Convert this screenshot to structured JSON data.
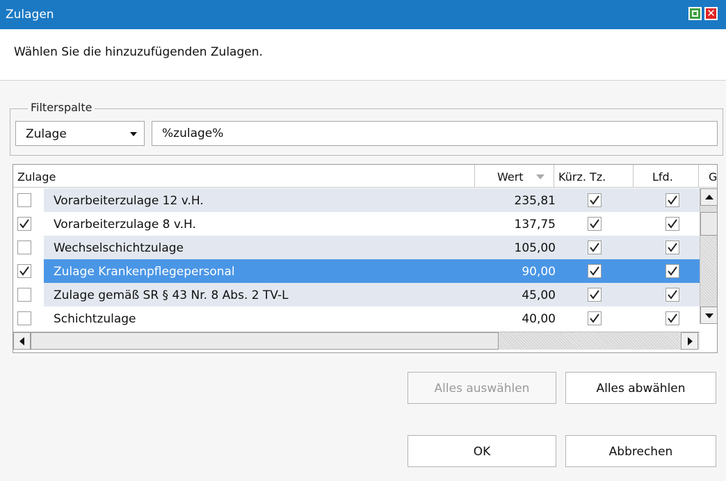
{
  "window": {
    "title": "Zulagen"
  },
  "instruction": "Wählen Sie die hinzuzufügenden Zulagen.",
  "filter": {
    "legend": "Filterspalte",
    "column": "Zulage",
    "value": "%zulage%"
  },
  "table": {
    "columns": [
      "Zulage",
      "Wert",
      "Kürz. Tz.",
      "Lfd.",
      "G"
    ],
    "sort_column": "Wert",
    "rows": [
      {
        "name": "Vorarbeiterzulage 12 v.H.",
        "wert": "235,81",
        "selected": false,
        "kuerz": true,
        "lfd": true
      },
      {
        "name": "Vorarbeiterzulage 8 v.H.",
        "wert": "137,75",
        "selected": true,
        "kuerz": true,
        "lfd": true
      },
      {
        "name": "Wechselschichtzulage",
        "wert": "105,00",
        "selected": false,
        "kuerz": true,
        "lfd": true
      },
      {
        "name": "Zulage Krankenpflegepersonal",
        "wert": "90,00",
        "selected": true,
        "kuerz": true,
        "lfd": true,
        "highlighted": true
      },
      {
        "name": "Zulage gemäß SR § 43 Nr. 8 Abs. 2 TV-L",
        "wert": "45,00",
        "selected": false,
        "kuerz": true,
        "lfd": true
      },
      {
        "name": "Schichtzulage",
        "wert": "40,00",
        "selected": false,
        "kuerz": true,
        "lfd": true
      }
    ]
  },
  "buttons": {
    "select_all": "Alles auswählen",
    "deselect_all": "Alles abwählen",
    "ok": "OK",
    "cancel": "Abbrechen"
  },
  "colors": {
    "titlebar": "#1b79c4",
    "row_alt": "#e3e8f0",
    "highlight": "#4a96e6"
  }
}
